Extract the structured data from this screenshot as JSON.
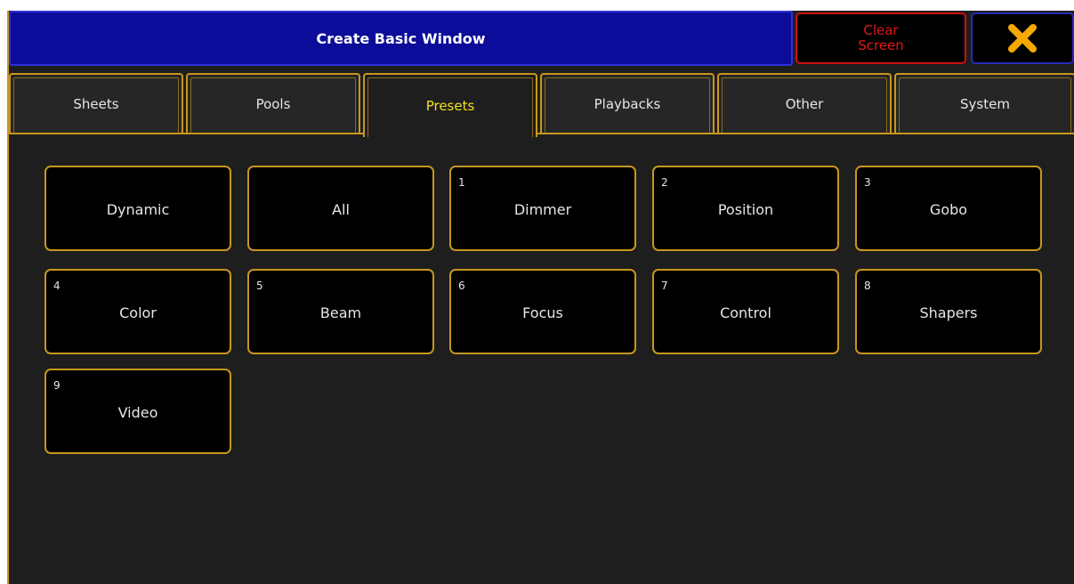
{
  "window": {
    "title": "Create Basic Window",
    "clear_button_line1": "Clear",
    "clear_button_line2": "Screen",
    "close_icon": "close-x-icon"
  },
  "tabs": [
    {
      "label": "Sheets",
      "active": false
    },
    {
      "label": "Pools",
      "active": false
    },
    {
      "label": "Presets",
      "active": true
    },
    {
      "label": "Playbacks",
      "active": false
    },
    {
      "label": "Other",
      "active": false
    },
    {
      "label": "System",
      "active": false
    }
  ],
  "presets": [
    {
      "number": "",
      "label": "Dynamic"
    },
    {
      "number": "",
      "label": "All"
    },
    {
      "number": "1",
      "label": "Dimmer"
    },
    {
      "number": "2",
      "label": "Position"
    },
    {
      "number": "3",
      "label": "Gobo"
    },
    {
      "number": "4",
      "label": "Color"
    },
    {
      "number": "5",
      "label": "Beam"
    },
    {
      "number": "6",
      "label": "Focus"
    },
    {
      "number": "7",
      "label": "Control"
    },
    {
      "number": "8",
      "label": "Shapers"
    },
    {
      "number": "9",
      "label": "Video"
    }
  ],
  "colors": {
    "background": "#1e1e1e",
    "accent_border": "#c8961e",
    "active_tab_text": "#f0e020",
    "title_bg": "#0c0c9a",
    "clear_text": "#e01818",
    "close_icon": "#f5a800"
  }
}
